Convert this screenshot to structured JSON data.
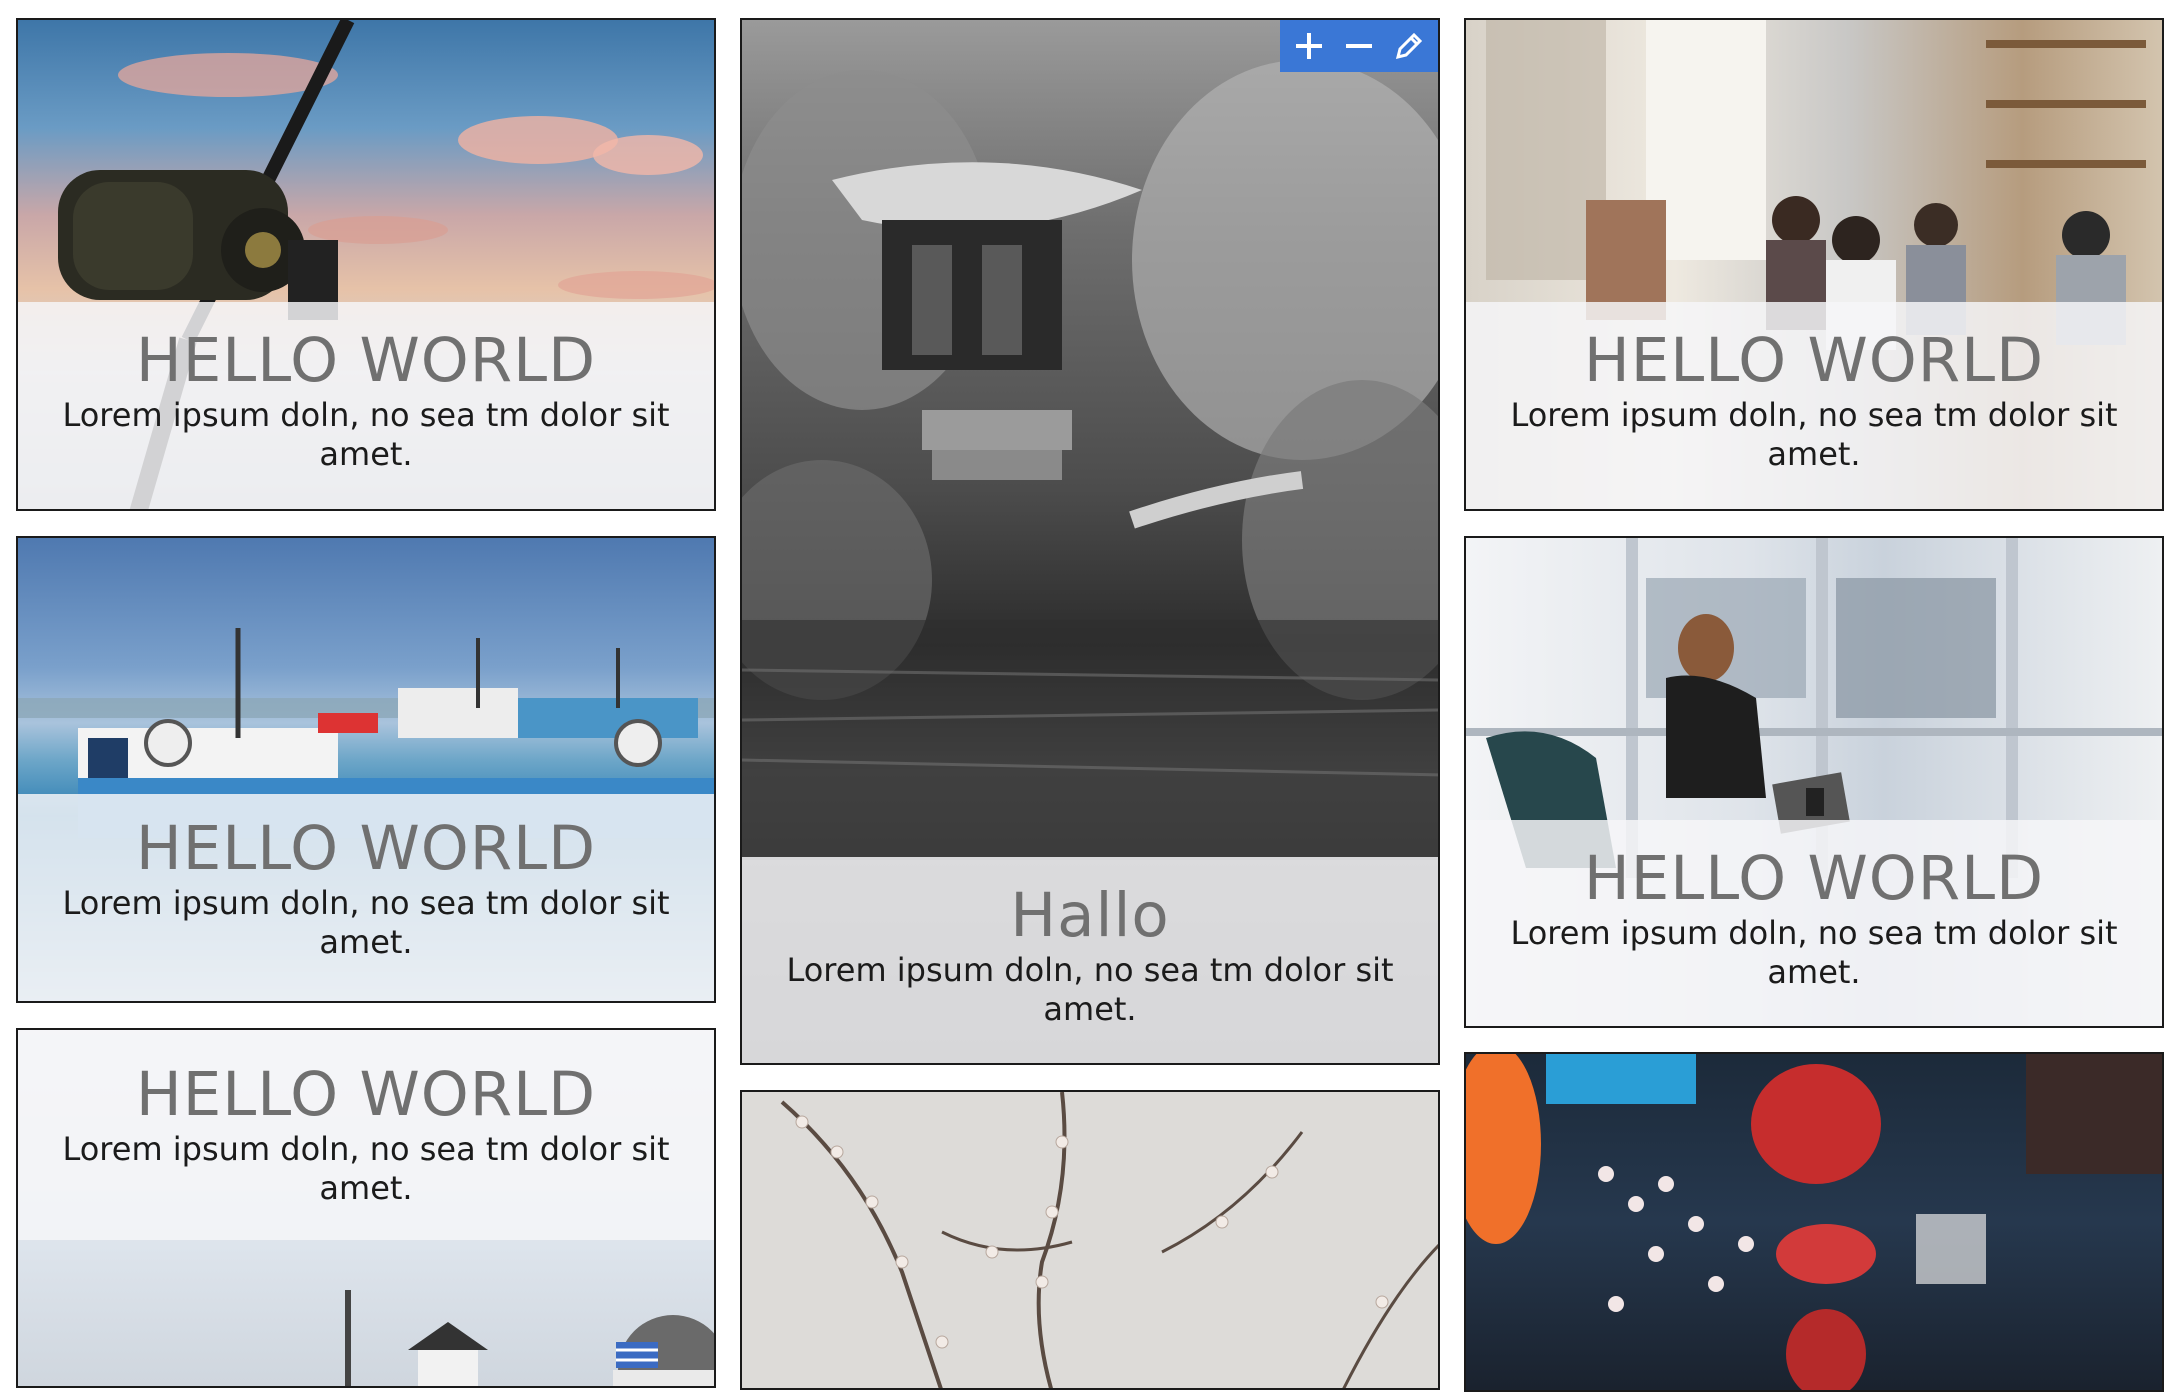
{
  "tiles": {
    "fishing": {
      "title": "HELLO WORLD",
      "text": "Lorem ipsum doln, no sea tm dolor sit amet."
    },
    "harbor": {
      "title": "HELLO WORLD",
      "text": "Lorem ipsum doln, no sea tm dolor sit amet."
    },
    "santorini": {
      "title": "HELLO WORLD",
      "text": "Lorem ipsum doln, no sea tm dolor sit amet."
    },
    "temple": {
      "title": "Hallo",
      "text": "Lorem ipsum doln, no sea tm dolor sit amet."
    },
    "blossom": {},
    "cafe": {
      "title": "HELLO WORLD",
      "text": "Lorem ipsum doln, no sea tm dolor sit amet."
    },
    "office": {
      "title": "HELLO WORLD",
      "text": "Lorem ipsum doln, no sea tm dolor sit amet."
    },
    "nightstreet": {}
  },
  "toolbar": {
    "icons": [
      "plus-icon",
      "minus-icon",
      "pencil-icon"
    ],
    "color": "#3a77d6"
  },
  "colors": {
    "tile_border": "#1a1a1a",
    "title_text": "#707070",
    "body_text": "#1b1b1b",
    "caption_bg": "#f6f6f8"
  }
}
